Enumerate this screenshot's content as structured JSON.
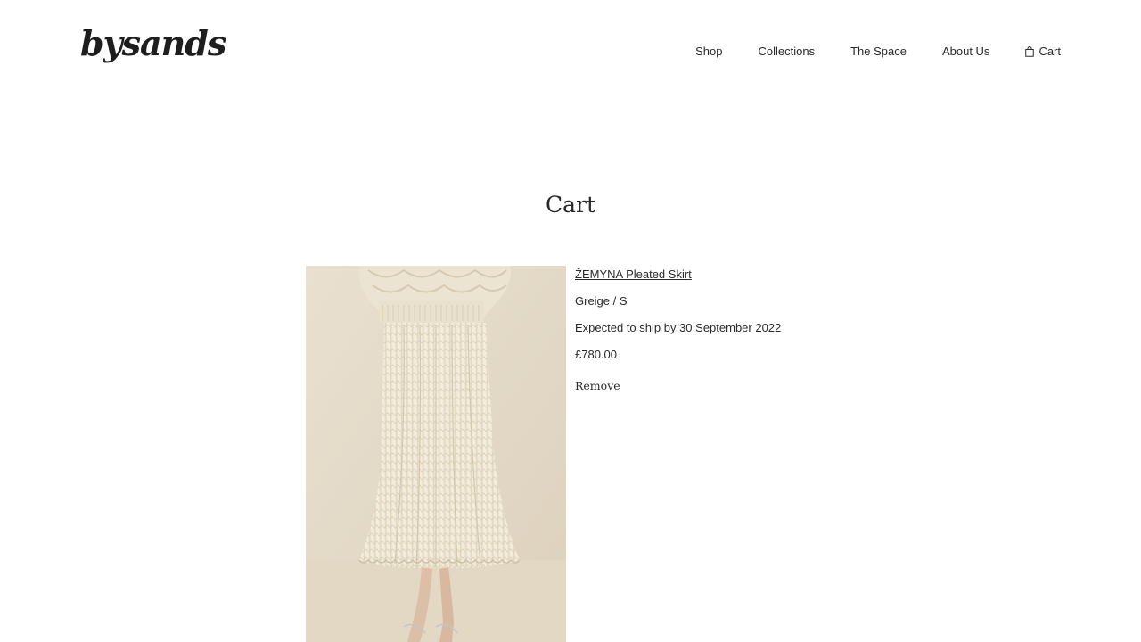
{
  "header": {
    "logo_text": "bysands",
    "nav": [
      {
        "label": "Shop"
      },
      {
        "label": "Collections"
      },
      {
        "label": "The Space"
      },
      {
        "label": "About Us"
      }
    ],
    "cart_label": "Cart",
    "cart_icon": "shopping-bag-icon"
  },
  "page": {
    "title": "Cart"
  },
  "cart": {
    "items": [
      {
        "name": "ŽEMYNA Pleated Skirt",
        "variant": "Greige / S",
        "shipping": "Expected to ship by 30 September 2022",
        "price": "£780.00",
        "remove_label": "Remove"
      }
    ]
  },
  "colors": {
    "text": "#2a2a2a",
    "background": "#ffffff",
    "image_background": "#e6dccb",
    "garment": "#f1ead8"
  }
}
